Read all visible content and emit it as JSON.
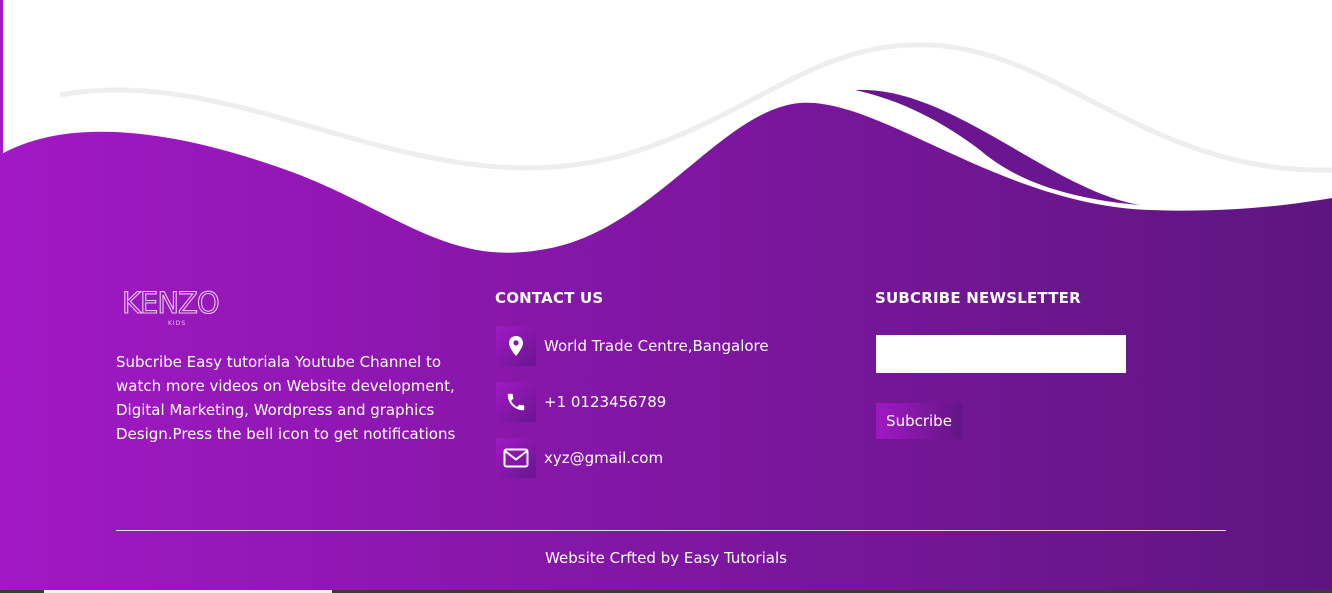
{
  "colors": {
    "gradient_start": "#a118c4",
    "gradient_end": "#5e1580",
    "text": "#ffffff"
  },
  "brand": {
    "logo_text": "KENZO",
    "logo_subtext": "KIDS"
  },
  "about": {
    "description": "Subcribe Easy tutoriala Youtube Channel to watch more videos on Website development, Digital Marketing, Wordpress and graphics Design.Press the bell icon to get notifications"
  },
  "contact": {
    "heading": "CONTACT US",
    "items": [
      {
        "icon": "location-pin-icon",
        "text": "World Trade Centre,Bangalore"
      },
      {
        "icon": "phone-icon",
        "text": "+1 0123456789"
      },
      {
        "icon": "envelope-icon",
        "text": "xyz@gmail.com"
      }
    ]
  },
  "newsletter": {
    "heading": "SUBCRIBE NEWSLETTER",
    "input_value": "",
    "input_placeholder": "",
    "button_label": "Subcribe"
  },
  "footer": {
    "credit": "Website Crfted by Easy Tutorials"
  }
}
